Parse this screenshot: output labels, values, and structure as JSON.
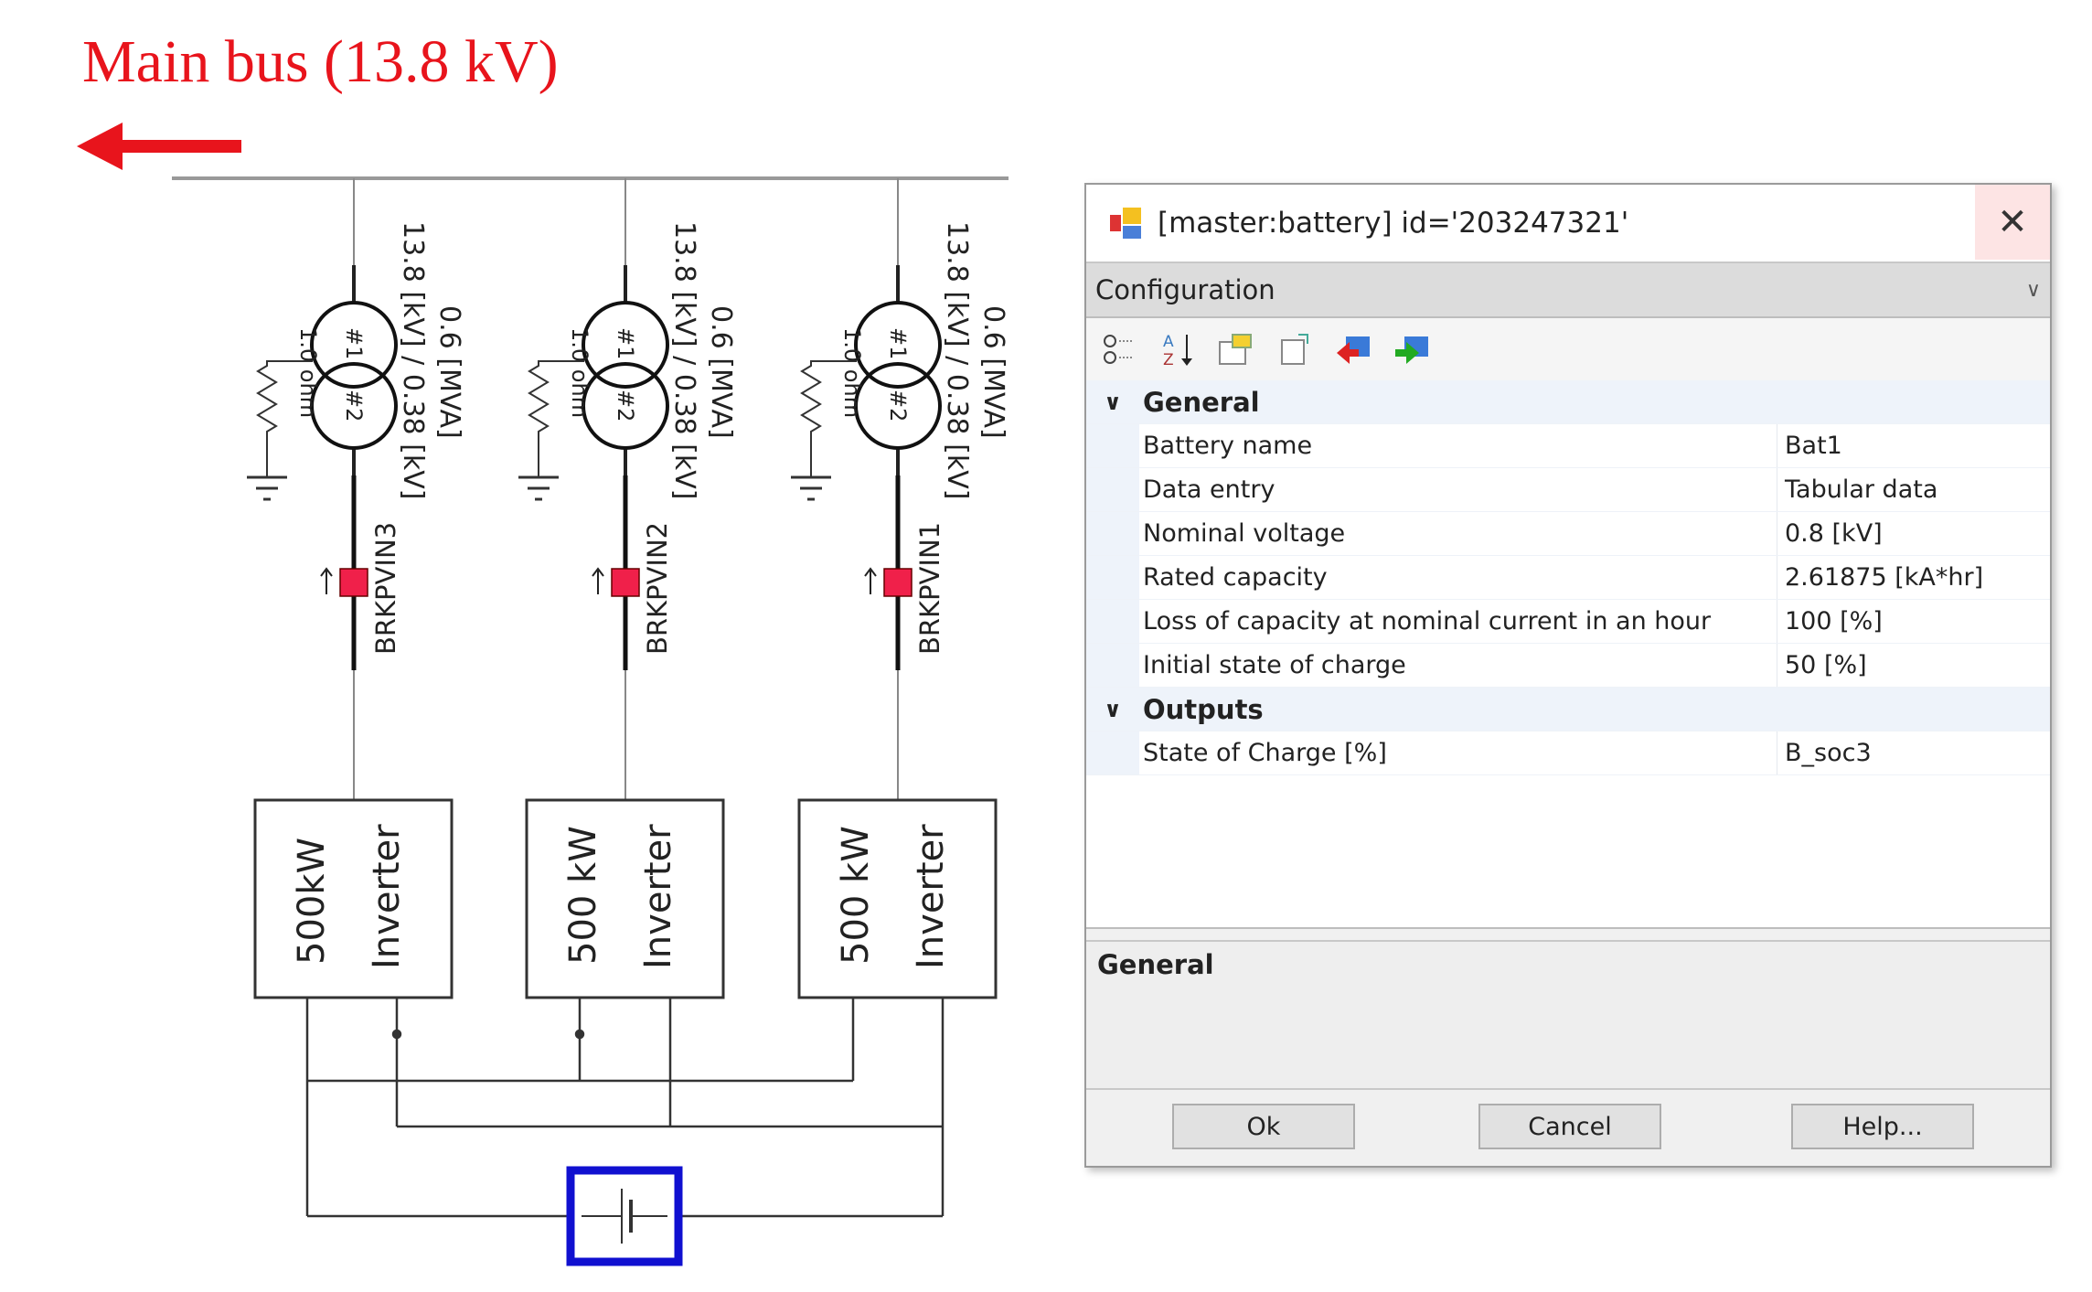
{
  "diagram": {
    "title": "Main bus (13.8 kV)",
    "feeders": [
      {
        "voltage": "13.8 [kV] / 0.38 [kV]",
        "rating": "0.6 [MVA]",
        "ground": "1.0 ohm",
        "w1": "#1",
        "w2": "#2",
        "breaker": "BRKPVIN3",
        "inv_power": "500kW",
        "inv_label": "Inverter"
      },
      {
        "voltage": "13.8 [kV] / 0.38 [kV]",
        "rating": "0.6 [MVA]",
        "ground": "1.0 ohm",
        "w1": "#1",
        "w2": "#2",
        "breaker": "BRKPVIN2",
        "inv_power": "500 kW",
        "inv_label": "Inverter"
      },
      {
        "voltage": "13.8 [kV] / 0.38 [kV]",
        "rating": "0.6 [MVA]",
        "ground": "1.0 ohm",
        "w1": "#1",
        "w2": "#2",
        "breaker": "BRKPVIN1",
        "inv_power": "500 kW",
        "inv_label": "Inverter"
      }
    ],
    "colors": {
      "title": "#e8141c",
      "breaker": "#f0204a",
      "battery": "#1010d0"
    }
  },
  "dialog": {
    "title": "[master:battery] id='203247321'",
    "close": "✕",
    "dropdown": "Configuration",
    "toolbar_icons": [
      "categorized-icon",
      "sort-alpha-icon",
      "properties-icon",
      "pages-icon",
      "import-icon",
      "export-icon"
    ],
    "categories": [
      {
        "name": "General",
        "rows": [
          {
            "name": "Battery name",
            "value": "Bat1"
          },
          {
            "name": "Data entry",
            "value": "Tabular data"
          },
          {
            "name": "Nominal voltage",
            "value": "0.8 [kV]"
          },
          {
            "name": "Rated capacity",
            "value": "2.61875 [kA*hr]"
          },
          {
            "name": "Loss of capacity at nominal current in an hour",
            "value": "100 [%]"
          },
          {
            "name": "Initial state of charge",
            "value": "50 [%]"
          }
        ]
      },
      {
        "name": "Outputs",
        "rows": [
          {
            "name": "State of Charge [%]",
            "value": "B_soc3"
          }
        ]
      }
    ],
    "description_title": "General",
    "buttons": {
      "ok": "Ok",
      "cancel": "Cancel",
      "help": "Help..."
    }
  }
}
